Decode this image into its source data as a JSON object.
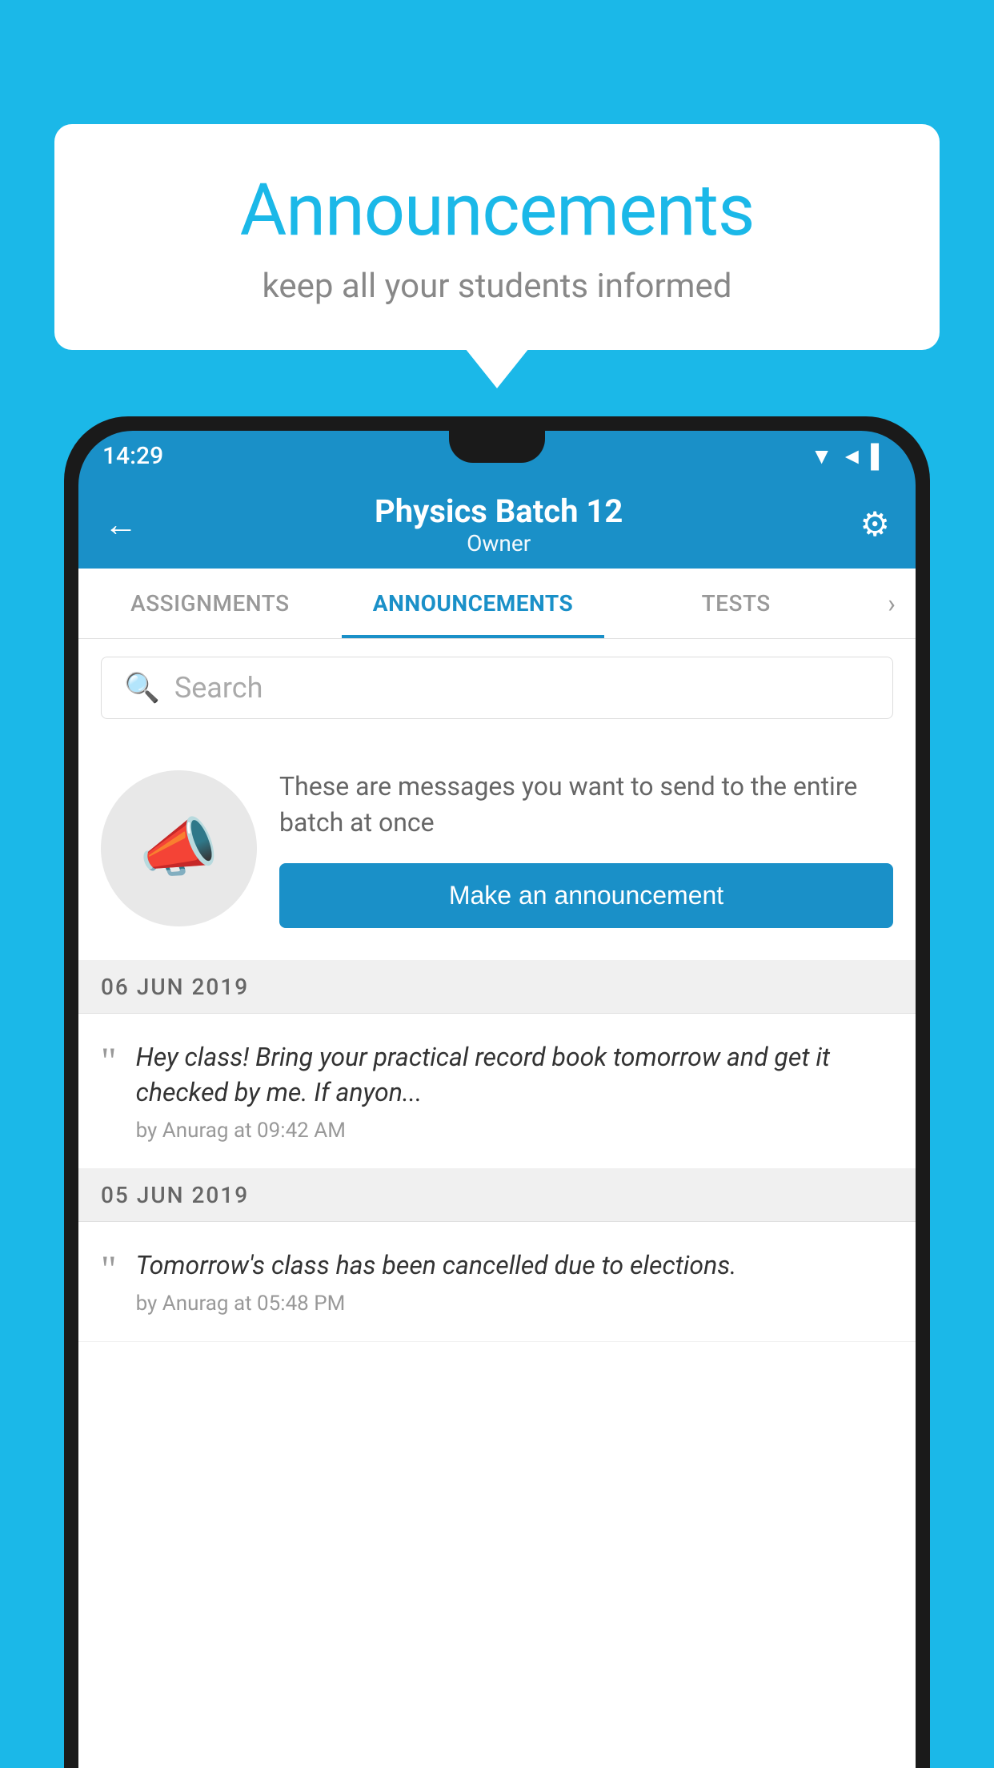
{
  "background": {
    "color": "#1BB8E8"
  },
  "speech_bubble": {
    "title": "Announcements",
    "subtitle": "keep all your students informed"
  },
  "phone": {
    "status_bar": {
      "time": "14:29",
      "icons": "▼◄▌"
    },
    "header": {
      "title": "Physics Batch 12",
      "subtitle": "Owner",
      "back_label": "←",
      "gear_label": "⚙"
    },
    "tabs": [
      {
        "label": "ASSIGNMENTS",
        "active": false
      },
      {
        "label": "ANNOUNCEMENTS",
        "active": true
      },
      {
        "label": "TESTS",
        "active": false
      }
    ],
    "search": {
      "placeholder": "Search"
    },
    "promo": {
      "description": "These are messages you want to send to the entire batch at once",
      "button_label": "Make an announcement"
    },
    "announcements": [
      {
        "date": "06  JUN  2019",
        "text": "Hey class! Bring your practical record book tomorrow and get it checked by me. If anyon...",
        "meta": "by Anurag at 09:42 AM"
      },
      {
        "date": "05  JUN  2019",
        "text": "Tomorrow's class has been cancelled due to elections.",
        "meta": "by Anurag at 05:48 PM"
      }
    ]
  }
}
